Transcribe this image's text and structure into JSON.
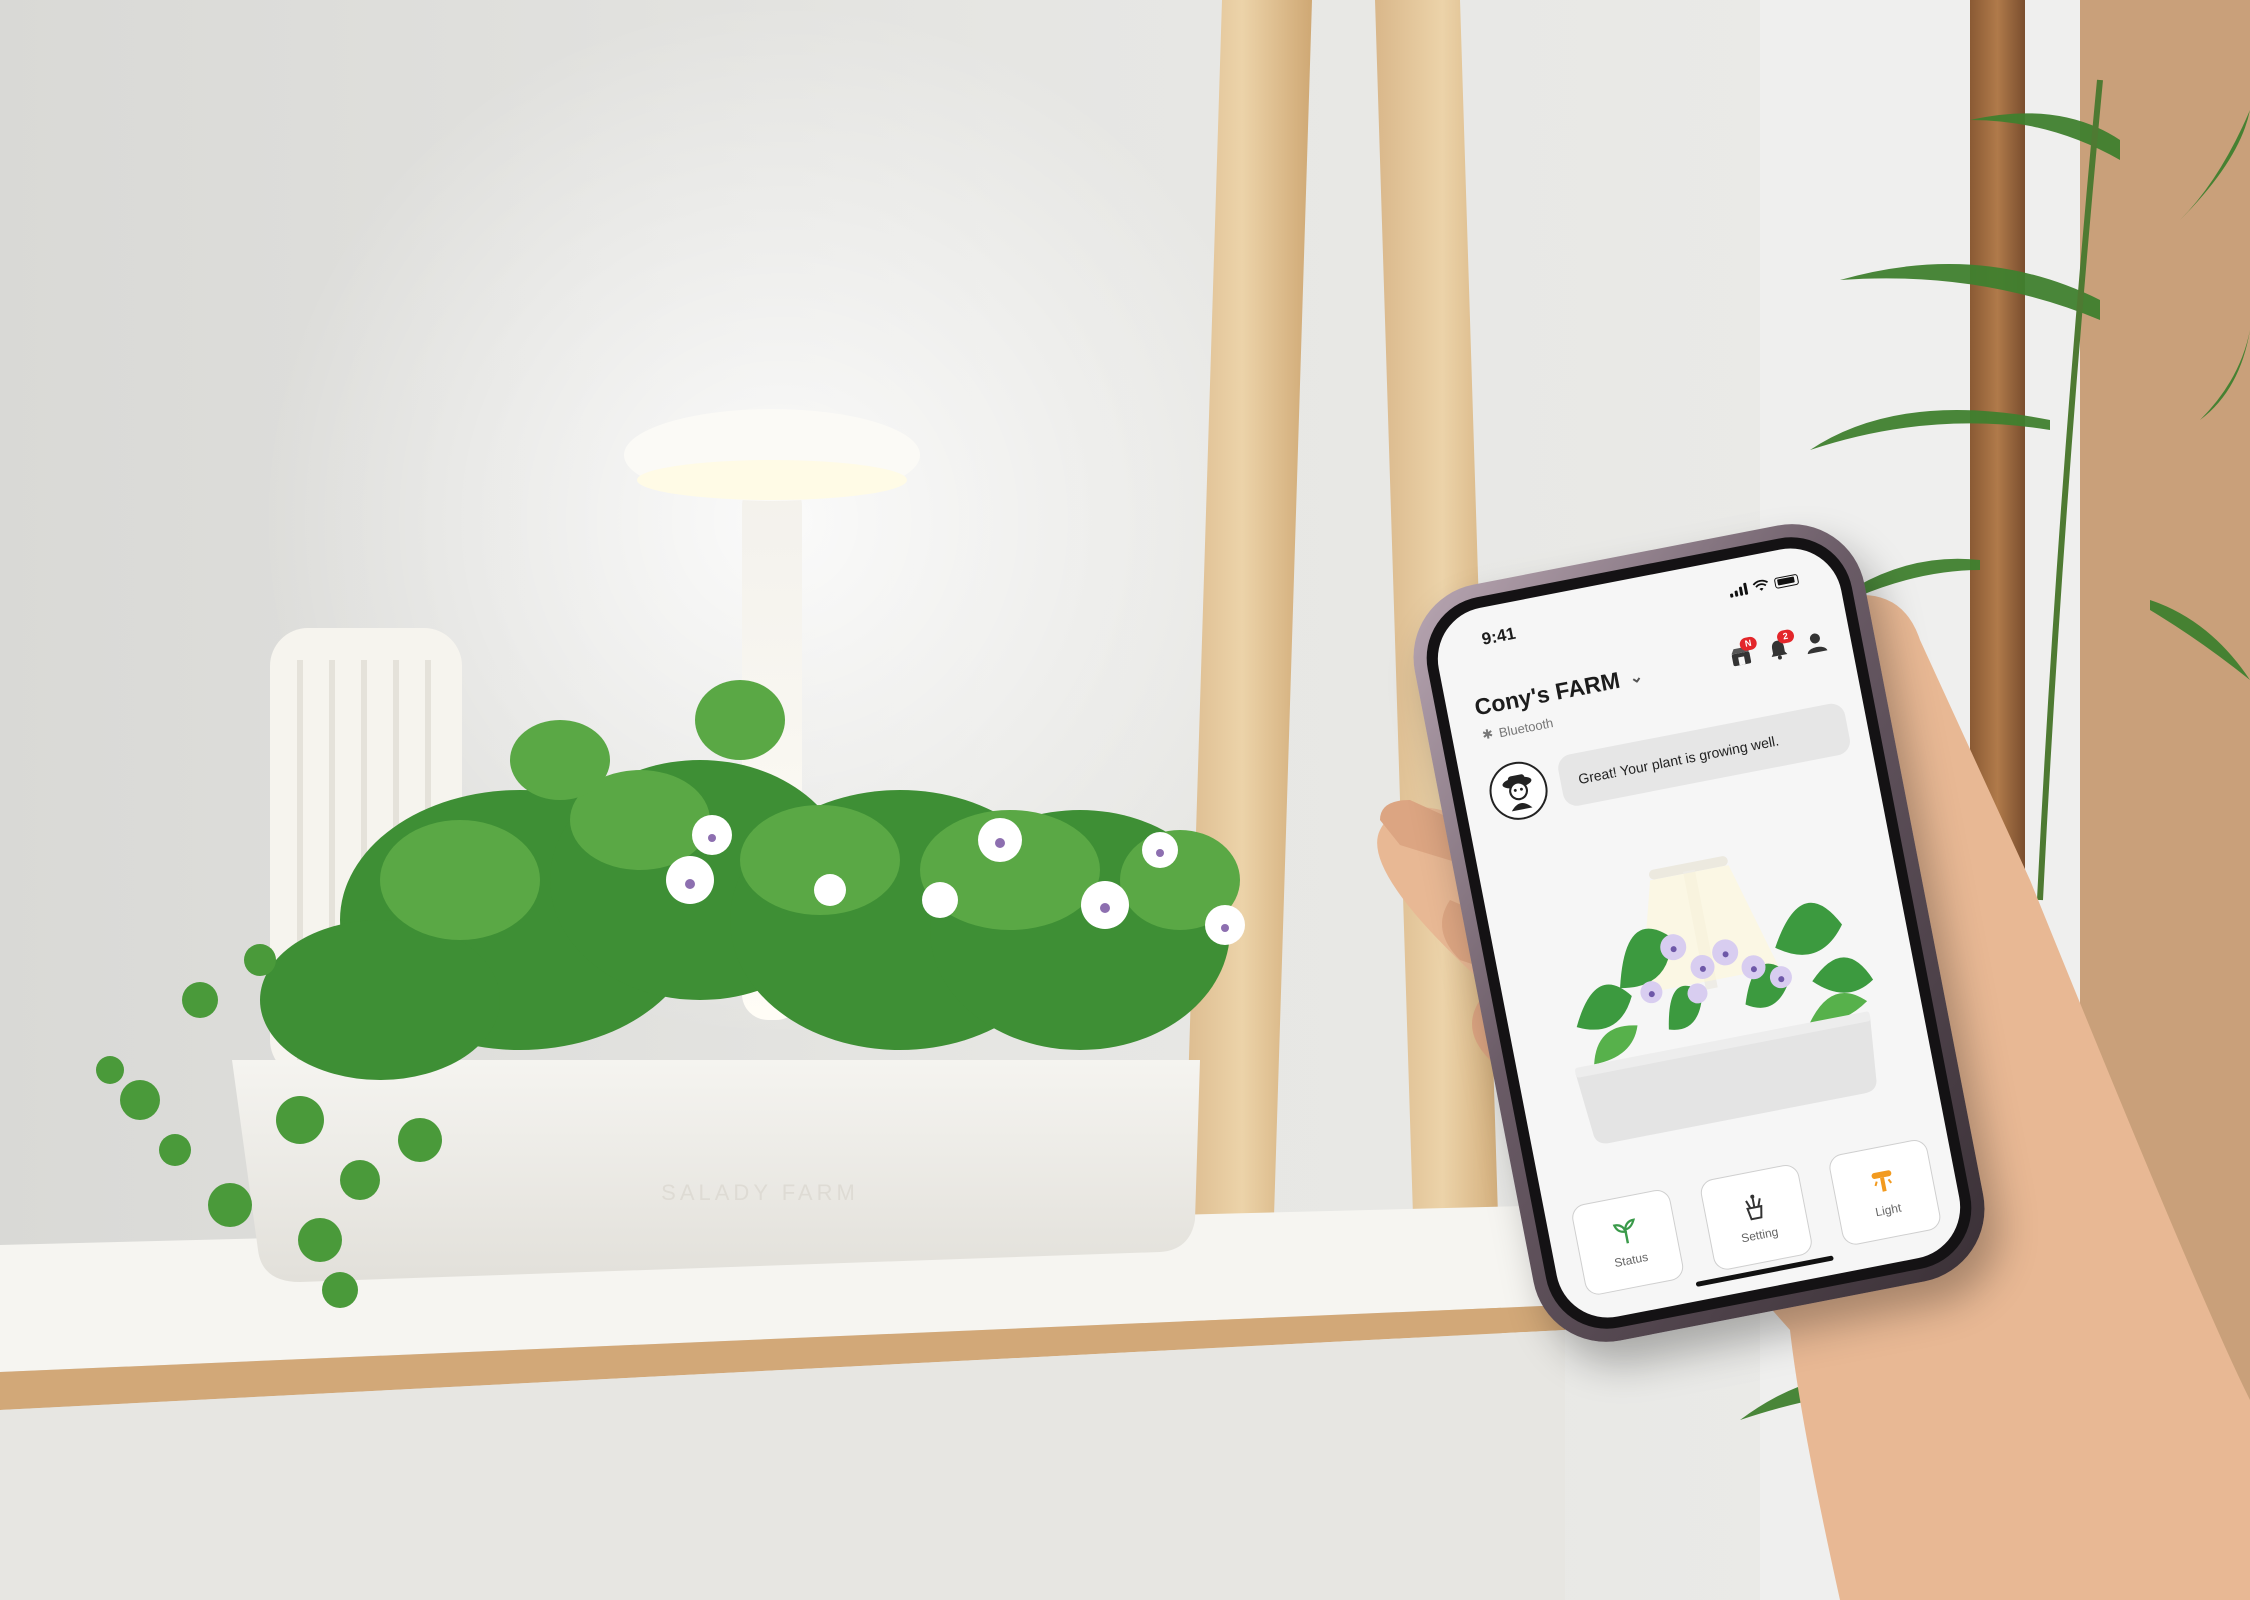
{
  "status_bar": {
    "time": "9:41"
  },
  "app": {
    "farm_name": "Cony's FARM",
    "connection": "Bluetooth",
    "badges": {
      "store": "N",
      "notifications": "2"
    },
    "message": "Great! Your plant is growing well."
  },
  "actions": [
    {
      "label": "Status",
      "icon": "sprout-icon"
    },
    {
      "label": "Setting",
      "icon": "plant-pot-icon"
    },
    {
      "label": "Light",
      "icon": "lamp-icon"
    }
  ],
  "colors": {
    "accent_green": "#3a9a4a",
    "accent_orange": "#f29a1f",
    "badge_red": "#e3262a"
  }
}
